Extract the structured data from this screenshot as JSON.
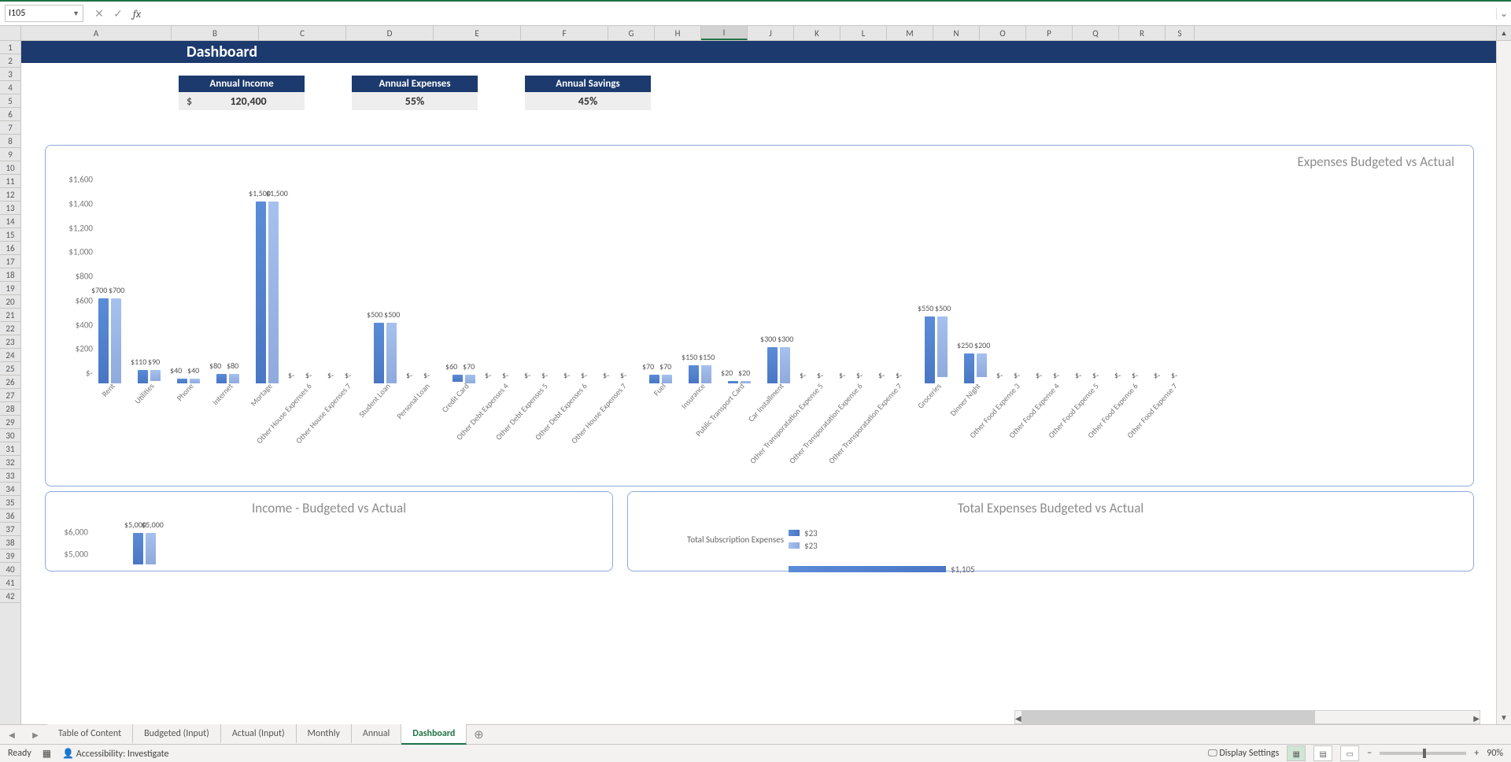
{
  "namebox": "I105",
  "formula": "",
  "zoom": "90%",
  "statusLeft": "Ready",
  "accessibility": "Accessibility: Investigate",
  "displaySettings": "Display Settings",
  "columns": [
    "A",
    "B",
    "C",
    "D",
    "E",
    "F",
    "G",
    "H",
    "I",
    "J",
    "K",
    "L",
    "M",
    "N",
    "O",
    "P",
    "Q",
    "R",
    "S"
  ],
  "selectedCol": "I",
  "rowCount": 42,
  "title": "Dashboard",
  "kpis": [
    {
      "label": "Annual Income",
      "value": "120,400",
      "prefix": "$"
    },
    {
      "label": "Annual Expenses",
      "value": "55%",
      "prefix": ""
    },
    {
      "label": "Annual Savings",
      "value": "45%",
      "prefix": ""
    }
  ],
  "tabs": [
    "Table of Content",
    "Budgeted (Input)",
    "Actual (Input)",
    "Monthly",
    "Annual",
    "Dashboard"
  ],
  "activeTab": "Dashboard",
  "chart_data": [
    {
      "type": "bar",
      "title": "Expenses Budgeted vs Actual",
      "ylim": [
        0,
        1600
      ],
      "yticks": [
        "$-",
        "$200",
        "$400",
        "$600",
        "$800",
        "$1,000",
        "$1,200",
        "$1,400",
        "$1,600"
      ],
      "categories": [
        "Rent",
        "Utilities",
        "Phone",
        "Internet",
        "Mortage",
        "Other House Expenses 6",
        "Other House Expenses 7",
        "Student Loan",
        "Personal Loan",
        "Credit Card",
        "Other Debt Expenses 4",
        "Other Debt Expenses 5",
        "Other Debt Expenses 6",
        "Other House Expenses 7",
        "Fuel",
        "Insurance",
        "Public Transport Card",
        "Car Installment",
        "Other Transporatation Expense 5",
        "Other Transporatation Expense 6",
        "Other Transporatation Expense 7",
        "Groceries",
        "Dinner Night",
        "Other Food Expense 3",
        "Other Food Expense 4",
        "Other Food Expense 5",
        "Other Food Expense 6",
        "Other Food Expense 7"
      ],
      "series": [
        {
          "name": "Budgeted",
          "values": [
            700,
            110,
            40,
            80,
            1500,
            0,
            0,
            500,
            0,
            60,
            0,
            0,
            0,
            0,
            70,
            150,
            20,
            300,
            0,
            0,
            0,
            550,
            250,
            0,
            0,
            0,
            0,
            0
          ]
        },
        {
          "name": "Actual",
          "values": [
            700,
            90,
            40,
            80,
            1500,
            0,
            0,
            500,
            0,
            70,
            0,
            0,
            0,
            0,
            70,
            150,
            20,
            300,
            0,
            0,
            0,
            500,
            200,
            0,
            0,
            0,
            0,
            0
          ]
        }
      ],
      "labels": [
        [
          "$700",
          "$700"
        ],
        [
          "$110",
          "$90"
        ],
        [
          "$40",
          "$40"
        ],
        [
          "$80",
          "$80"
        ],
        [
          "$1,500",
          "$1,500"
        ],
        [
          "$-",
          "$-"
        ],
        [
          "$-",
          "$-"
        ],
        [
          "$500",
          "$500"
        ],
        [
          "$-",
          "$-"
        ],
        [
          "$60",
          "$70"
        ],
        [
          "$-",
          "$-"
        ],
        [
          "$-",
          "$-"
        ],
        [
          "$-",
          "$-"
        ],
        [
          "$-",
          "$-"
        ],
        [
          "$70",
          "$70"
        ],
        [
          "$150",
          "$150"
        ],
        [
          "$20",
          "$20"
        ],
        [
          "$300",
          "$300"
        ],
        [
          "$-",
          "$-"
        ],
        [
          "$-",
          "$-"
        ],
        [
          "$-",
          "$-"
        ],
        [
          "$550",
          "$500"
        ],
        [
          "$250",
          "$200"
        ],
        [
          "$-",
          "$-"
        ],
        [
          "$-",
          "$-"
        ],
        [
          "$-",
          "$-"
        ],
        [
          "$-",
          "$-"
        ],
        [
          "$-",
          "$-"
        ]
      ]
    },
    {
      "type": "bar",
      "title": "Income - Budgeted vs Actual",
      "ylim": [
        0,
        6000
      ],
      "yticks": [
        "$5,000",
        "$6,000"
      ],
      "categories": [
        ""
      ],
      "series": [
        {
          "name": "Budgeted",
          "values": [
            5000
          ]
        },
        {
          "name": "Actual",
          "values": [
            5000
          ]
        }
      ],
      "labels": [
        [
          "$5,000",
          "$5,000"
        ]
      ]
    },
    {
      "type": "bar_h",
      "title": "Total Expenses Budgeted vs Actual",
      "categories": [
        "Total Subscription Expenses"
      ],
      "series": [
        {
          "name": "Budgeted",
          "values": [
            23
          ]
        },
        {
          "name": "Actual",
          "values": [
            23
          ]
        }
      ],
      "labels": [
        [
          "$23",
          "$23"
        ]
      ],
      "partial_next": "$1,105"
    }
  ]
}
